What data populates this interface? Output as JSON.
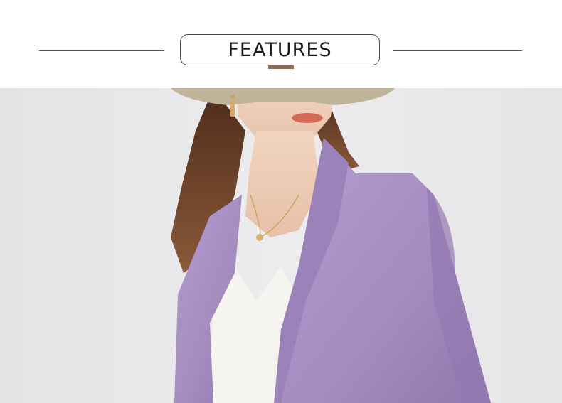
{
  "header": {
    "title": "FEATURES",
    "accent_color": "#8c6a58",
    "rule_color": "#555555"
  },
  "photo": {
    "background_color": "#e9e9ea",
    "jacket_color": "#a58cc2",
    "top_color": "#f6f4f1",
    "hat_color": "#bfb49a",
    "hair_color": "#6b3f27",
    "skin_color": "#eecdb6"
  }
}
